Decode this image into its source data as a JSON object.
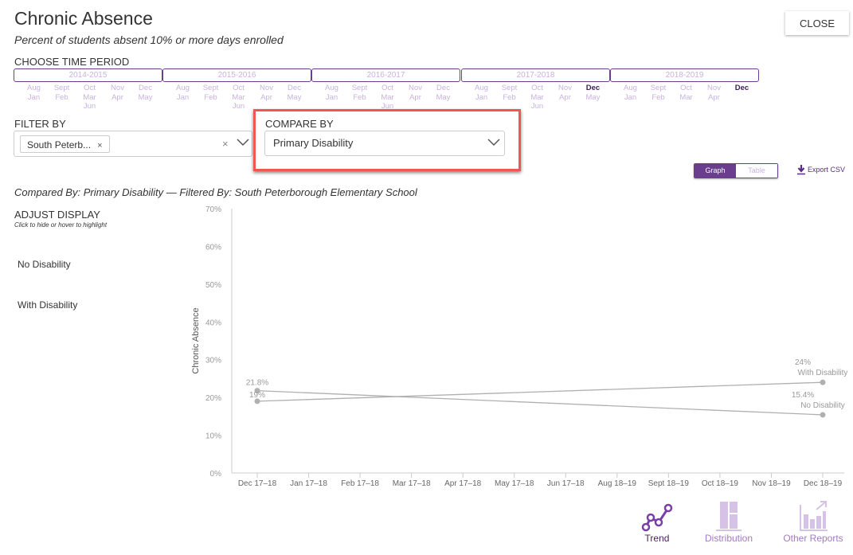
{
  "header": {
    "title": "Chronic Absence",
    "subtitle": "Percent of students absent 10% or more days enrolled",
    "close_label": "CLOSE"
  },
  "time_period": {
    "label": "CHOOSE TIME PERIOD",
    "years": [
      {
        "label": "2014-2015",
        "months": [
          [
            "Aug",
            "Jan"
          ],
          [
            "Sept",
            "Feb"
          ],
          [
            "Oct",
            "Mar",
            "Jun"
          ],
          [
            "Nov",
            "Apr"
          ],
          [
            "Dec",
            "May"
          ]
        ],
        "selected": []
      },
      {
        "label": "2015-2016",
        "months": [
          [
            "Aug",
            "Jan"
          ],
          [
            "Sept",
            "Feb"
          ],
          [
            "Oct",
            "Mar",
            "Jun"
          ],
          [
            "Nov",
            "Apr"
          ],
          [
            "Dec",
            "May"
          ]
        ],
        "selected": []
      },
      {
        "label": "2016-2017",
        "months": [
          [
            "Aug",
            "Jan"
          ],
          [
            "Sept",
            "Feb"
          ],
          [
            "Oct",
            "Mar",
            "Jun"
          ],
          [
            "Nov",
            "Apr"
          ],
          [
            "Dec",
            "May"
          ]
        ],
        "selected": []
      },
      {
        "label": "2017-2018",
        "months": [
          [
            "Aug",
            "Jan"
          ],
          [
            "Sept",
            "Feb"
          ],
          [
            "Oct",
            "Mar",
            "Jun"
          ],
          [
            "Nov",
            "Apr"
          ],
          [
            "Dec",
            "May"
          ]
        ],
        "selected": [
          "Dec"
        ]
      },
      {
        "label": "2018-2019",
        "months": [
          [
            "Aug",
            "Jan"
          ],
          [
            "Sept",
            "Feb"
          ],
          [
            "Oct",
            "Mar"
          ],
          [
            "Nov",
            "Apr"
          ],
          [
            "Dec"
          ]
        ],
        "selected": [
          "Dec"
        ]
      }
    ]
  },
  "filter": {
    "label": "FILTER BY",
    "tag": "South Peterb...",
    "tag_remove": "×",
    "clear": "×"
  },
  "compare": {
    "label": "COMPARE BY",
    "value": "Primary Disability"
  },
  "view_toggle": {
    "graph": "Graph",
    "table": "Table",
    "active": "Graph"
  },
  "export_label": "Export CSV",
  "caption": "Compared By: Primary Disability — Filtered By: South Peterborough Elementary School",
  "adjust_display": {
    "label": "ADJUST DISPLAY",
    "sub": "Click to hide or hover to highlight",
    "items": [
      "No Disability",
      "With Disability"
    ]
  },
  "bottom_nav": [
    {
      "label": "Trend",
      "icon": "trend-icon",
      "active": true
    },
    {
      "label": "Distribution",
      "icon": "distribution-icon",
      "active": false
    },
    {
      "label": "Other Reports",
      "icon": "other-reports-icon",
      "active": false
    }
  ],
  "colors": {
    "accent": "#6b3d8e",
    "accent_light": "#c9b3dd",
    "highlight": "#f0584f",
    "series": "#b0b0b0"
  },
  "chart_data": {
    "type": "line",
    "title": "",
    "xlabel": "",
    "ylabel": "Chronic Absence",
    "ylim": [
      0,
      70
    ],
    "yticks": [
      "0%",
      "10%",
      "20%",
      "30%",
      "40%",
      "50%",
      "60%",
      "70%"
    ],
    "categories": [
      "Dec 17–18",
      "Jan 17–18",
      "Feb 17–18",
      "Mar 17–18",
      "Apr 17–18",
      "May 17–18",
      "Jun 17–18",
      "Aug 18–19",
      "Sept 18–19",
      "Oct 18–19",
      "Nov 18–19",
      "Dec 18–19"
    ],
    "grid": false,
    "series": [
      {
        "name": "No Disability",
        "points": [
          {
            "x": "Dec 17–18",
            "y": 21.8,
            "label": "21.8%"
          },
          {
            "x": "Dec 18–19",
            "y": 15.4,
            "label": "15.4%"
          }
        ]
      },
      {
        "name": "With Disability",
        "points": [
          {
            "x": "Dec 17–18",
            "y": 19,
            "label": "19%"
          },
          {
            "x": "Dec 18–19",
            "y": 24,
            "label": "24%"
          }
        ]
      }
    ]
  }
}
